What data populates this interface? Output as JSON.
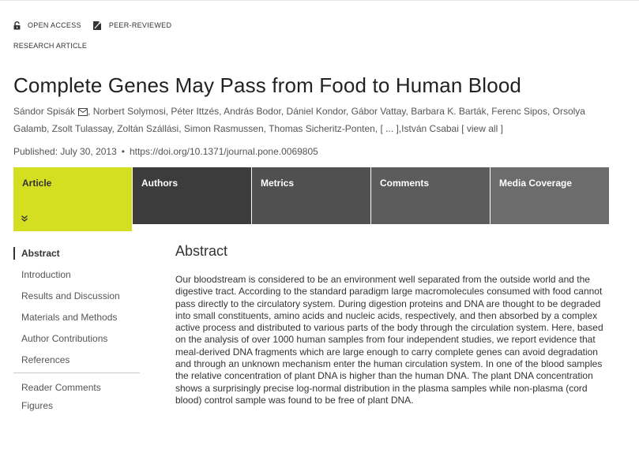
{
  "badges": {
    "open_access": "OPEN ACCESS",
    "peer_reviewed": "PEER-REVIEWED"
  },
  "article_type": "RESEARCH ARTICLE",
  "title": "Complete Genes May Pass from Food to Human Blood",
  "authors": [
    "Sándor Spisák",
    "Norbert Solymosi",
    "Péter Ittzés",
    "András Bodor",
    "Dániel Kondor",
    "Gábor Vattay",
    "Barbara K. Barták",
    "Ferenc Sipos",
    "Orsolya Galamb",
    "Zsolt Tulassay",
    "Zoltán Szállási",
    "Simon Rasmussen",
    "Thomas Sicheritz-Ponten"
  ],
  "authors_more": "[ ... ]",
  "last_author": "István Csabai",
  "view_all": "[ view all ]",
  "published": "Published: July 30, 2013",
  "doi": "https://doi.org/10.1371/journal.pone.0069805",
  "tabs": [
    "Article",
    "Authors",
    "Metrics",
    "Comments",
    "Media Coverage"
  ],
  "nav": {
    "sections": [
      "Abstract",
      "Introduction",
      "Results and Discussion",
      "Materials and Methods",
      "Author Contributions",
      "References"
    ],
    "extra": [
      "Reader Comments",
      "Figures"
    ]
  },
  "abstract": {
    "heading": "Abstract",
    "text": "Our bloodstream is considered to be an environment well separated from the outside world and the digestive tract. According to the standard paradigm large macromolecules consumed with food cannot pass directly to the circulatory system. During digestion proteins and DNA are thought to be degraded into small constituents, amino acids and nucleic acids, respectively, and then absorbed by a complex active process and distributed to various parts of the body through the circulation system. Here, based on the analysis of over 1000 human samples from four independent studies, we report evidence that meal-derived DNA fragments which are large enough to carry complete genes can avoid degradation and through an unknown mechanism enter the human circulation system. In one of the blood samples the relative concentration of plant DNA is higher than the human DNA. The plant DNA concentration shows a surprisingly precise log-normal distribution in the plasma samples while non-plasma (cord blood) control sample was found to be free of plant DNA."
  },
  "colors": {
    "active_tab": "#d5df21",
    "tab_dark": "#3c3c3c"
  }
}
